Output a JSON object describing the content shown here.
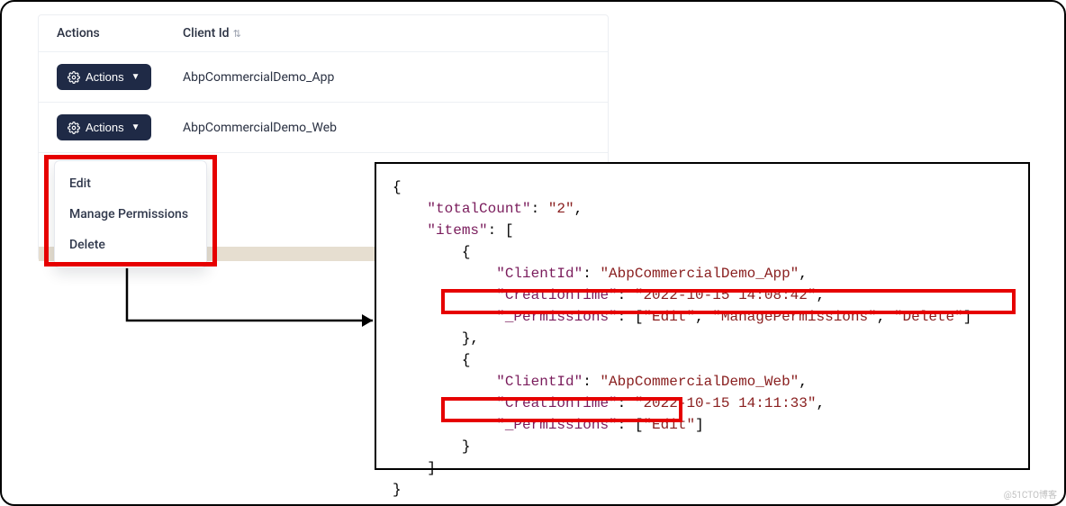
{
  "table": {
    "header": {
      "actions": "Actions",
      "clientId": "Client Id"
    },
    "rows": [
      {
        "actionsLabel": "Actions",
        "clientId": "AbpCommercialDemo_App"
      },
      {
        "actionsLabel": "Actions",
        "clientId": "AbpCommercialDemo_Web"
      }
    ]
  },
  "dropdown": {
    "items": [
      "Edit",
      "Manage Permissions",
      "Delete"
    ]
  },
  "code": {
    "open1": "{",
    "k_totalCount": "\"totalCount\"",
    "v_totalCount": "\"2\"",
    "k_items": "\"items\"",
    "open_arr": "[",
    "open_obj": "{",
    "k_clientId": "\"ClientId\"",
    "v_clientId1": "\"AbpCommercialDemo_App\"",
    "k_creationTime": "\"CreationTime\"",
    "v_creationTime1": "\"2022-10-15 14:08:42\"",
    "k_permissions": "\"_Permissions\"",
    "v_perm1_a": "\"Edit\"",
    "v_perm1_b": "\"ManagePermissions\"",
    "v_perm1_c": "\"Delete\"",
    "close_obj_comma": "},",
    "v_clientId2": "\"AbpCommercialDemo_Web\"",
    "v_creationTime2": "\"2022-10-15 14:11:33\"",
    "v_perm2_a": "\"Edit\"",
    "close_obj": "}",
    "close_arr": "]",
    "close1": "}"
  },
  "watermark": "@51CTO博客"
}
